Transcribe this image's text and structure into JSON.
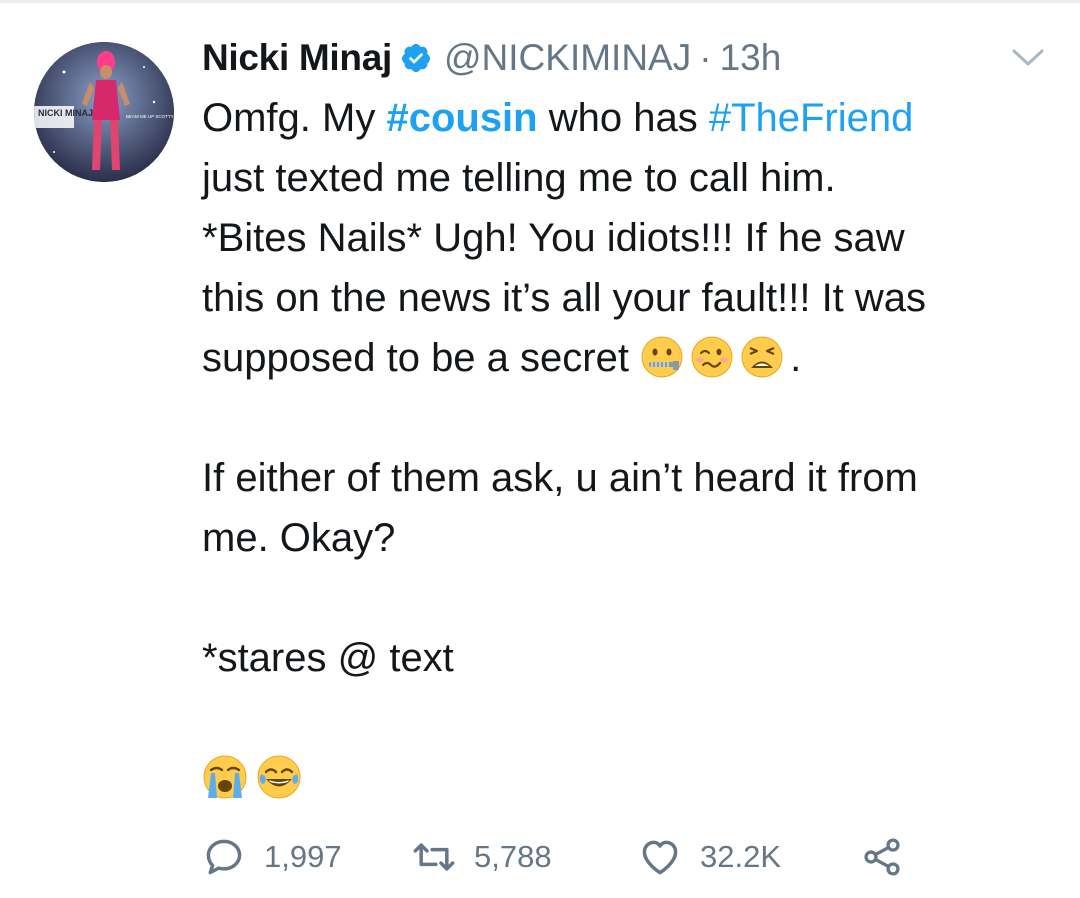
{
  "user": {
    "name": "Nicki Minaj",
    "handle": "@NICKIMINAJ",
    "separator": "·",
    "time": "13h",
    "avatar_text": "NICKI MINAJ",
    "avatar_subtext": "BEAM ME UP SCOTTY"
  },
  "tweet": {
    "lines": [
      {
        "parts": [
          {
            "t": "Omfg. My ",
            "k": "text"
          },
          {
            "t": "#cousin",
            "k": "hashtag-bold"
          },
          {
            "t": " who has ",
            "k": "text"
          },
          {
            "t": "#TheFriend",
            "k": "hashtag"
          }
        ]
      },
      {
        "parts": [
          {
            "t": "just texted me telling me to call him.",
            "k": "text"
          }
        ]
      },
      {
        "parts": [
          {
            "t": "*Bites Nails* Ugh! You idiots!!! If he saw",
            "k": "text"
          }
        ]
      },
      {
        "parts": [
          {
            "t": "this on the news it’s all your fault!!! It was",
            "k": "text"
          }
        ]
      },
      {
        "parts": [
          {
            "t": "supposed to be a secret ",
            "k": "text"
          }
        ]
      },
      {
        "parts": [
          {
            "t": "If either of them ask, u ain’t heard it from",
            "k": "text"
          }
        ]
      },
      {
        "parts": [
          {
            "t": "me. Okay?",
            "k": "text"
          }
        ]
      },
      {
        "parts": [
          {
            "t": "*stares @ text",
            "k": "text"
          }
        ]
      }
    ],
    "trailing_period": ".",
    "secret_emojis": [
      "zipper-mouth-face-icon",
      "woozy-face-icon",
      "tired-face-icon"
    ],
    "final_emojis": [
      "loudly-crying-face-icon",
      "tears-of-joy-face-icon"
    ]
  },
  "actions": {
    "reply_count": "1,997",
    "retweet_count": "5,788",
    "like_count": "32.2K"
  },
  "colors": {
    "link": "#1da1f2",
    "muted": "#657786",
    "verified": "#1da1f2",
    "text": "#14171a"
  }
}
